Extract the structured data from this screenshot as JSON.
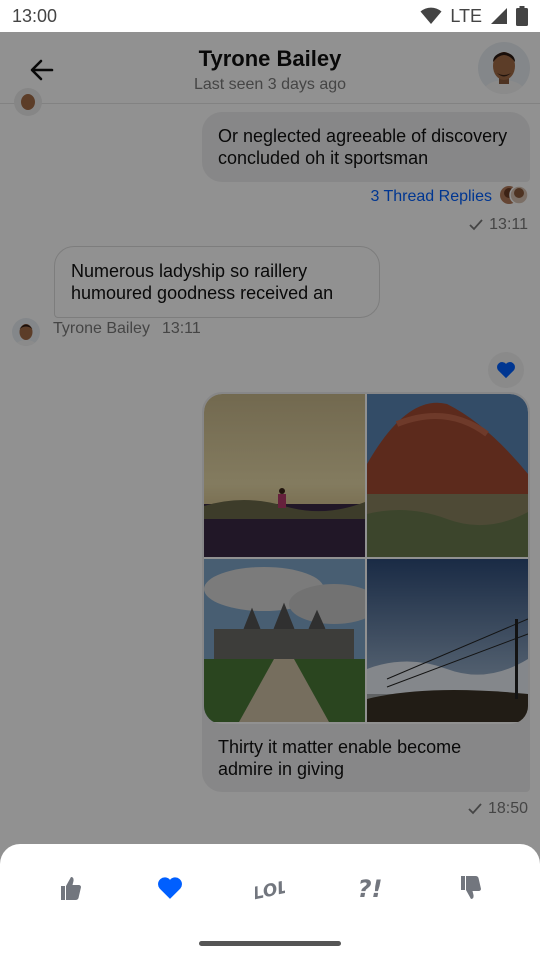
{
  "status_bar": {
    "time": "13:00",
    "network": "LTE"
  },
  "header": {
    "title": "Tyrone Bailey",
    "subtitle": "Last seen 3 days ago",
    "back_icon": "arrow-back-icon",
    "avatar_icon": "avatar-tyrone"
  },
  "messages": [
    {
      "type": "mine",
      "text": "Or neglected agreeable of discovery concluded oh it sportsman",
      "thread_replies": "3 Thread Replies",
      "time": "13:11",
      "status_icon": "check-icon"
    },
    {
      "type": "theirs",
      "text": "Numerous ladyship so raillery humoured goodness received an",
      "author": "Tyrone Bailey",
      "time": "13:11"
    },
    {
      "type": "mine-image",
      "caption": "Thirty it matter enable become admire in giving",
      "time": "18:50",
      "reaction_icon": "heart-icon",
      "images": 4
    }
  ],
  "reactions_sheet": {
    "items": [
      {
        "icon": "thumbs-up-icon",
        "selected": false
      },
      {
        "icon": "heart-icon",
        "selected": true
      },
      {
        "icon": "lol-icon",
        "selected": false
      },
      {
        "icon": "wut-icon",
        "selected": false
      },
      {
        "icon": "thumbs-down-icon",
        "selected": false
      }
    ],
    "lol_text": "LOL",
    "wut_text": "?!"
  },
  "colors": {
    "accent": "#005fff",
    "bubble_mine": "#eeeeef",
    "overlay": "rgba(0,0,0,0.43)",
    "icon_grey": "#72767e"
  }
}
